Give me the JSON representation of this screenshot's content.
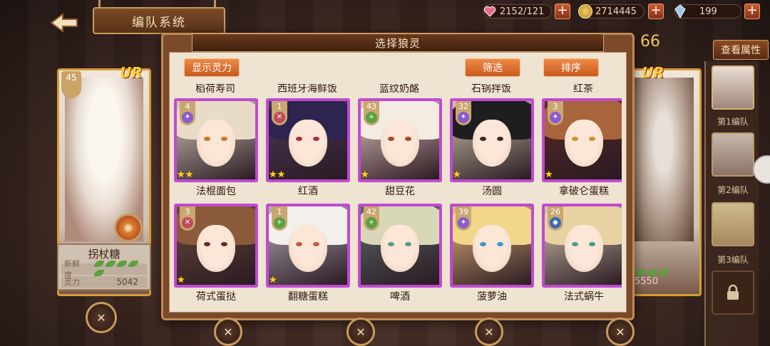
{
  "header": {
    "title": "编队系统",
    "resources": [
      {
        "icon": "heart-icon",
        "value": "2152/121",
        "color": "#e86a8a"
      },
      {
        "icon": "gold-coin-icon",
        "value": "2714445",
        "color": "#d8a02a"
      },
      {
        "icon": "crystal-icon",
        "value": "199",
        "color": "#9ac8e8"
      }
    ],
    "check_attributes": "查看属性",
    "power_partial": "66"
  },
  "left_card": {
    "rarity": "UR",
    "level": "45",
    "name": "拐杖糖",
    "freshness_label": "新鲜度",
    "power_label": "灵力",
    "power_value": "5042"
  },
  "right_card": {
    "rarity": "UR",
    "power_value": "5550"
  },
  "team_tabs": [
    "第1编队",
    "第2编队",
    "第3编队"
  ],
  "modal": {
    "title": "选择狼灵",
    "show_power_button": "显示灵力",
    "filter_button": "筛选",
    "sort_button": "排序",
    "previous_row": [
      "稻荷寿司",
      "西班牙海鲜饭",
      "蓝纹奶酪",
      "石锅拌饭",
      "红茶"
    ],
    "cards": [
      {
        "name": "法棍面包",
        "level": "4",
        "stars": 2,
        "hair": "#e8dcc6",
        "bg": "#d8cfc0",
        "eye": "#c8781e",
        "gem": "#8a5ad0",
        "gem_icon": "sparkle-icon"
      },
      {
        "name": "红酒",
        "level": "1",
        "stars": 2,
        "hair": "#2e2450",
        "bg": "#4a3a5a",
        "eye": "#b02a3a",
        "gem": "#c04a5a",
        "gem_icon": "cross-icon"
      },
      {
        "name": "甜豆花",
        "level": "43",
        "stars": 1,
        "hair": "#f2ece2",
        "bg": "#e8c8c0",
        "eye": "#a04a2a",
        "gem": "#5aa040",
        "gem_icon": "plus-icon"
      },
      {
        "name": "汤圆",
        "level": "32",
        "stars": 1,
        "hair": "#1e1e1e",
        "bg": "#d2c8b0",
        "eye": "#3a2a20",
        "gem": "#8a5ad0",
        "gem_icon": "sparkle-icon"
      },
      {
        "name": "拿破仑蛋糕",
        "level": "3",
        "stars": 1,
        "hair": "#a8643a",
        "bg": "#5a2a24",
        "eye": "#d0902a",
        "gem": "#8a5ad0",
        "gem_icon": "sparkle-icon"
      },
      {
        "name": "荷式蛋挞",
        "level": "3",
        "stars": 1,
        "hair": "#8a5a3a",
        "bg": "#6a4a3a",
        "eye": "#6a2a1a",
        "gem": "#c04a5a",
        "gem_icon": "cross-icon"
      },
      {
        "name": "翻糖蛋糕",
        "level": "1",
        "stars": 1,
        "hair": "#f4f0ec",
        "bg": "#b8b0b8",
        "eye": "#c05a3a",
        "gem": "#5aa040",
        "gem_icon": "plus-icon"
      },
      {
        "name": "啤酒",
        "level": "42",
        "stars": 0,
        "hair": "#d8d8b8",
        "bg": "#5a6a6a",
        "eye": "#5a9a8a",
        "gem": "#5aa040",
        "gem_icon": "plus-icon"
      },
      {
        "name": "菠萝油",
        "level": "39",
        "stars": 0,
        "hair": "#f2d68a",
        "bg": "#e8b87a",
        "eye": "#3a9ac8",
        "gem": "#8a5ad0",
        "gem_icon": "sparkle-icon"
      },
      {
        "name": "法式蜗牛",
        "level": "26",
        "stars": 0,
        "hair": "#e8d2a2",
        "bg": "#d8c8b0",
        "eye": "#4a9a8a",
        "gem": "#3a6ab0",
        "gem_icon": "shield-icon"
      }
    ]
  }
}
